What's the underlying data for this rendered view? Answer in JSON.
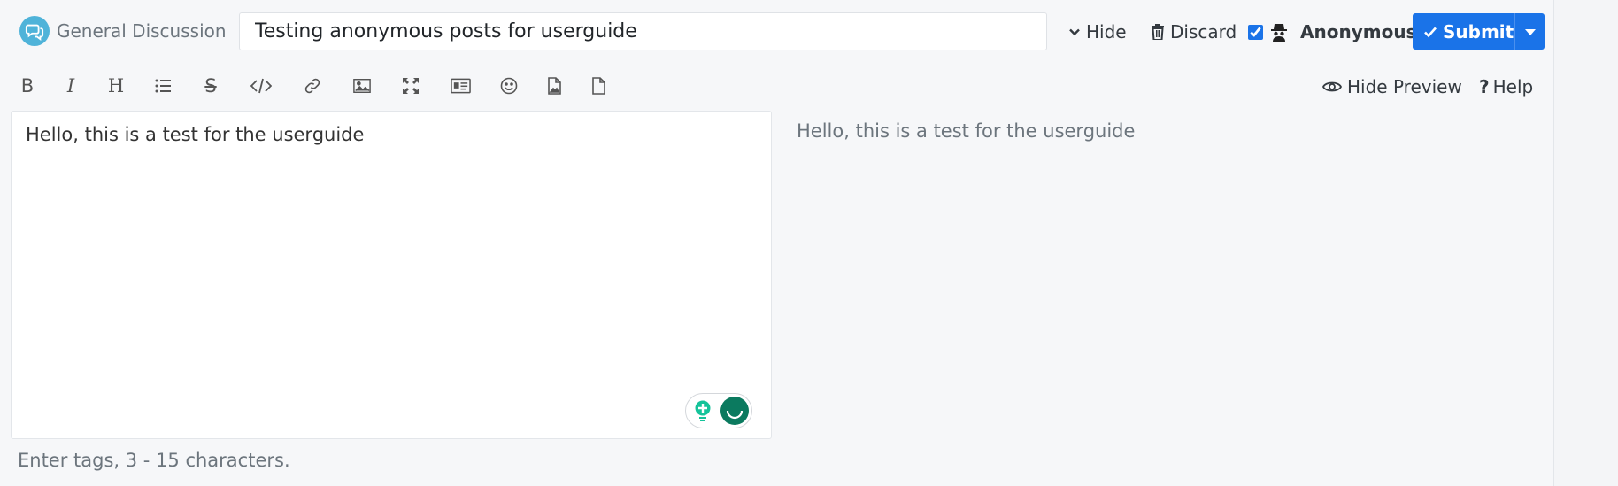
{
  "header": {
    "category_label": "General Discussion",
    "title_value": "Testing anonymous posts for userguide",
    "hide_label": "Hide",
    "discard_label": "Discard",
    "anonymous_label": "Anonymous",
    "anonymous_checked": true,
    "submit_label": "Submit"
  },
  "toolbar": {
    "items": [
      "bold-icon",
      "italic-icon",
      "heading-icon",
      "list-icon",
      "strikethrough-icon",
      "code-icon",
      "link-icon",
      "image-icon",
      "fullscreen-icon",
      "card-icon",
      "emoji-icon",
      "image-file-icon",
      "file-icon"
    ],
    "preview_label": "Hide Preview",
    "help_label": "Help"
  },
  "editor": {
    "value": "Hello, this is a test for the userguide"
  },
  "preview": {
    "text": "Hello, this is a test for the userguide"
  },
  "tags": {
    "placeholder": "Enter tags, 3 - 15 characters."
  },
  "colors": {
    "accent": "#1a73e8",
    "category": "#4fb3d9",
    "grammarly": "#0b7a5f"
  }
}
